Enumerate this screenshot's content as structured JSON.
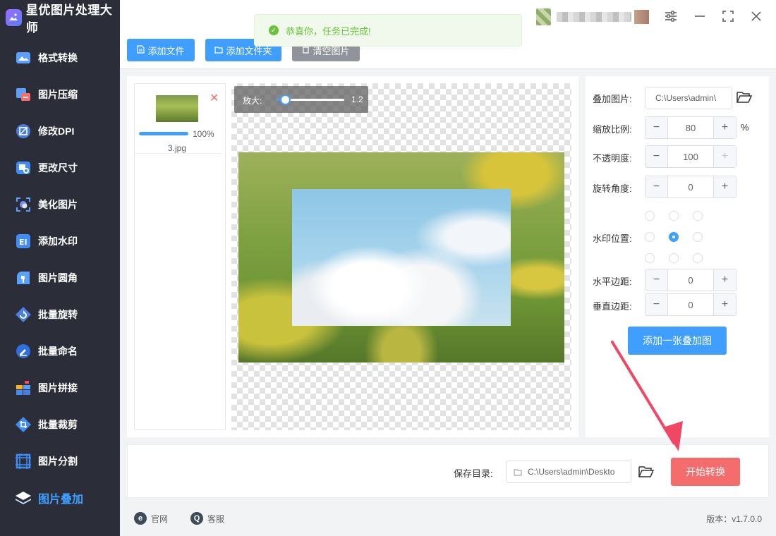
{
  "app": {
    "title": "星优图片处理大师"
  },
  "sidebar": {
    "items": [
      {
        "label": "格式转换",
        "icon": "format-convert-icon"
      },
      {
        "label": "图片压缩",
        "icon": "compress-icon"
      },
      {
        "label": "修改DPI",
        "icon": "dpi-icon"
      },
      {
        "label": "更改尺寸",
        "icon": "resize-icon"
      },
      {
        "label": "美化图片",
        "icon": "beautify-icon"
      },
      {
        "label": "添加水印",
        "icon": "watermark-icon"
      },
      {
        "label": "图片圆角",
        "icon": "rounded-corner-icon"
      },
      {
        "label": "批量旋转",
        "icon": "rotate-icon"
      },
      {
        "label": "批量命名",
        "icon": "rename-icon"
      },
      {
        "label": "图片拼接",
        "icon": "stitch-icon"
      },
      {
        "label": "批量裁剪",
        "icon": "crop-icon"
      },
      {
        "label": "图片分割",
        "icon": "split-icon"
      },
      {
        "label": "图片叠加",
        "icon": "overlay-layers-icon",
        "active": true
      }
    ]
  },
  "toolbar": {
    "add_file": "添加文件",
    "add_folder": "添加文件夹",
    "clear_images": "清空图片"
  },
  "toast": {
    "message": "恭喜你，任务已完成!"
  },
  "files": [
    {
      "name": "3.jpg",
      "progress": 100,
      "progress_text": "100%"
    }
  ],
  "preview": {
    "zoom_label": "放大:",
    "zoom_value": "1.2",
    "zoom_fraction": 0.12
  },
  "settings": {
    "overlay_image_label": "叠加图片:",
    "overlay_image_path": "C:\\Users\\admin\\",
    "scale_label": "缩放比例:",
    "scale_value": "80",
    "scale_unit": "%",
    "opacity_label": "不透明度:",
    "opacity_value": "100",
    "rotation_label": "旋转角度:",
    "rotation_value": "0",
    "position_label": "水印位置:",
    "position_selected": "center",
    "h_margin_label": "水平边距:",
    "h_margin_value": "0",
    "v_margin_label": "垂直边距:",
    "v_margin_value": "0",
    "add_overlay_button": "添加一张叠加图",
    "minus": "−",
    "plus": "+"
  },
  "bottom": {
    "save_dir_label": "保存目录:",
    "save_dir_path": "C:\\Users\\admin\\Deskto",
    "start_button": "开始转换"
  },
  "footer": {
    "website": "官网",
    "website_icon_glyph": "e",
    "support": "客服",
    "support_icon_glyph": "Q",
    "version": "版本：v1.7.0.0"
  },
  "colors": {
    "accent": "#409eff",
    "danger": "#f56c6c",
    "success": "#67c23a",
    "sidebar_bg": "#2b2e38"
  }
}
